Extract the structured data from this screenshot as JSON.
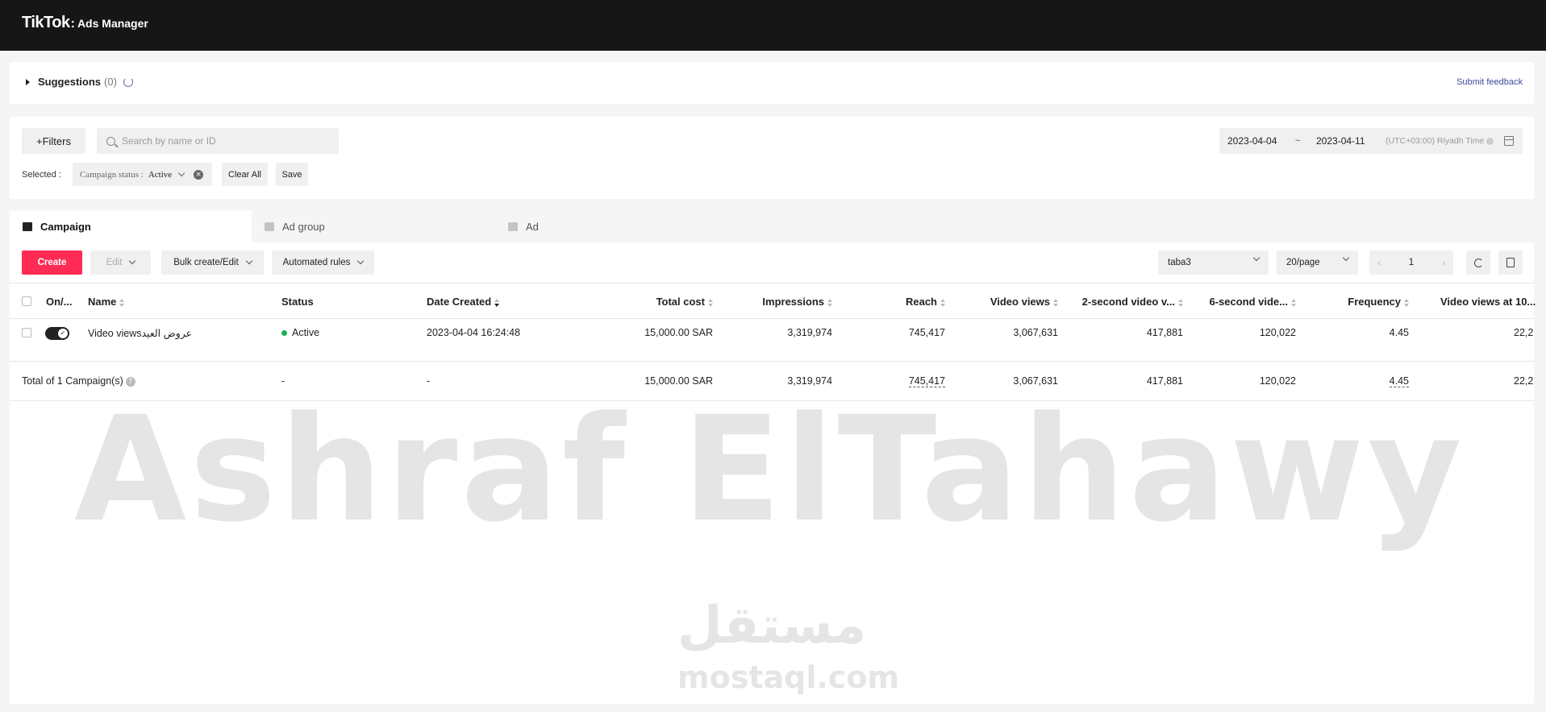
{
  "header": {
    "logo": "TikTok",
    "separator": ":",
    "product": "Ads Manager"
  },
  "suggestions": {
    "title": "Suggestions",
    "count": "(0)",
    "feedback": "Submit feedback"
  },
  "filters": {
    "button": "+Filters",
    "search_placeholder": "Search by name or ID",
    "selected_label": "Selected :",
    "chip_key": "Campaign status :",
    "chip_value": "Active",
    "clear_all": "Clear All",
    "save": "Save",
    "date_start": "2023-04-04",
    "date_sep": "~",
    "date_end": "2023-04-11",
    "timezone": "(UTC+03:00) Riyadh Time"
  },
  "tabs": [
    {
      "label": "Campaign",
      "active": true
    },
    {
      "label": "Ad group",
      "active": false
    },
    {
      "label": "Ad",
      "active": false
    }
  ],
  "toolbar": {
    "create": "Create",
    "edit": "Edit",
    "bulk": "Bulk create/Edit",
    "automated": "Automated rules",
    "account_select": "taba3",
    "page_size": "20/page",
    "page": "1"
  },
  "table": {
    "columns": [
      "On/...",
      "Name",
      "Status",
      "Date Created",
      "Total cost",
      "Impressions",
      "Reach",
      "Video views",
      "2-second video v...",
      "6-second vide...",
      "Frequency",
      "Video views at 10..."
    ],
    "rows": [
      {
        "name": "Video viewsعروض العيد",
        "status": "Active",
        "date_created": "2023-04-04 16:24:48",
        "total_cost": "15,000.00 SAR",
        "impressions": "3,319,974",
        "reach": "745,417",
        "video_views": "3,067,631",
        "views_2s": "417,881",
        "views_6s": "120,022",
        "frequency": "4.45",
        "views_10": "22,2"
      }
    ],
    "total": {
      "label": "Total of 1 Campaign(s)",
      "status": "-",
      "date_created": "-",
      "total_cost": "15,000.00 SAR",
      "impressions": "3,319,974",
      "reach": "745,417",
      "video_views": "3,067,631",
      "views_2s": "417,881",
      "views_6s": "120,022",
      "frequency": "4.45",
      "views_10": "22,2"
    }
  },
  "watermark": {
    "name": "Ashraf ElTahawy",
    "arabic": "مستقل",
    "site": "mostaql.com"
  },
  "colors": {
    "topbar": "#161616",
    "accent": "#fe2c55",
    "active_status": "#19b05c",
    "link": "#3c4a9a"
  }
}
